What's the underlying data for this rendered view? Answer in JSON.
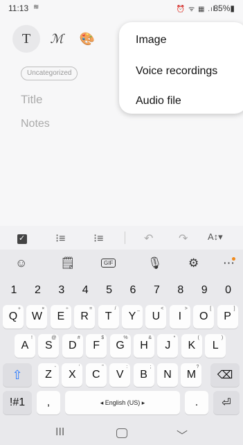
{
  "status": {
    "time": "11:13",
    "time_icon": "≋",
    "icons": "⏰ ᯤ ▦ .ıl",
    "battery": "85%▮"
  },
  "toolbar": {
    "text_icon": "T",
    "pen_icon": "ℳ",
    "palette_icon": "🎨"
  },
  "menu": {
    "items": [
      "Image",
      "Voice recordings",
      "Audio file"
    ]
  },
  "note": {
    "category": "Uncategorized",
    "title_placeholder": "Title",
    "notes_placeholder": "Notes"
  },
  "format": {
    "numlist": "⁝≡",
    "bullet": "⁝≡",
    "undo": "↶",
    "redo": "↷",
    "size": "A↕▾"
  },
  "keyboard": {
    "tools": {
      "emoji": "☺",
      "sticker": "🗒",
      "gif": "GIF",
      "mic": "🎙",
      "settings": "⚙",
      "more": "⋯"
    },
    "numbers": [
      "1",
      "2",
      "3",
      "4",
      "5",
      "6",
      "7",
      "8",
      "9",
      "0"
    ],
    "row1": [
      "Q",
      "W",
      "E",
      "R",
      "T",
      "Y",
      "U",
      "I",
      "O",
      "P"
    ],
    "row1_hints": [
      "+",
      "×",
      "÷",
      "=",
      "/",
      "_",
      "<",
      ">",
      "[",
      "]"
    ],
    "row2": [
      "A",
      "S",
      "D",
      "F",
      "G",
      "H",
      "J",
      "K",
      "L"
    ],
    "row2_hints": [
      "!",
      "@",
      "#",
      "$",
      "%",
      "&",
      "*",
      "(",
      ")"
    ],
    "row3": [
      "Z",
      "X",
      "C",
      "V",
      "B",
      "N",
      "M"
    ],
    "row3_hints": [
      "-",
      "'",
      "\"",
      ":",
      ";",
      "",
      "?"
    ],
    "shift": "⇧",
    "backspace": "⌫",
    "symbols": "!#1",
    "comma": ",",
    "space": "◂     English (US)     ▸",
    "period": ".",
    "enter": "⏎"
  },
  "nav": {
    "recent": "III",
    "home": "",
    "back": "﹀"
  }
}
